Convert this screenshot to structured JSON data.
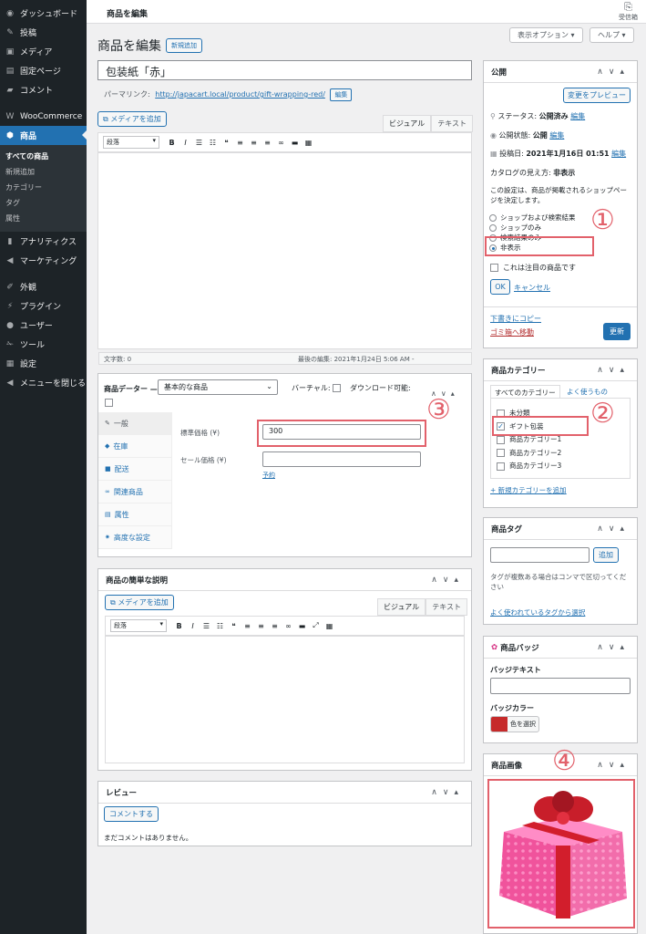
{
  "sidebar": {
    "items_top": [
      {
        "icon": "dashboard-icon",
        "glyph": "◉",
        "label": "ダッシュボード"
      },
      {
        "icon": "pin-icon",
        "glyph": "✎",
        "label": "投稿"
      },
      {
        "icon": "media-icon",
        "glyph": "▣",
        "label": "メディア"
      },
      {
        "icon": "page-icon",
        "glyph": "▤",
        "label": "固定ページ"
      },
      {
        "icon": "comment-icon",
        "glyph": "▰",
        "label": "コメント"
      }
    ],
    "woocommerce": {
      "icon": "woo-icon",
      "glyph": "W",
      "label": "WooCommerce"
    },
    "products": {
      "icon": "box-icon",
      "glyph": "⬢",
      "label": "商品"
    },
    "sub_items": [
      "すべての商品",
      "新規追加",
      "カテゴリー",
      "タグ",
      "属性"
    ],
    "items_mid": [
      {
        "icon": "chart-icon",
        "glyph": "▮",
        "label": "アナリティクス"
      },
      {
        "icon": "megaphone-icon",
        "glyph": "◀",
        "label": "マーケティング"
      }
    ],
    "items_bottom": [
      {
        "icon": "brush-icon",
        "glyph": "✐",
        "label": "外観"
      },
      {
        "icon": "plugin-icon",
        "glyph": "⚡",
        "label": "プラグイン"
      },
      {
        "icon": "user-icon",
        "glyph": "●",
        "label": "ユーザー"
      },
      {
        "icon": "wrench-icon",
        "glyph": "✁",
        "label": "ツール"
      },
      {
        "icon": "settings-icon",
        "glyph": "▦",
        "label": "設定"
      },
      {
        "icon": "collapse-icon",
        "glyph": "◀",
        "label": "メニューを閉じる"
      }
    ]
  },
  "topbar": {
    "title": "商品を編集",
    "inbox": "受信箱"
  },
  "screen": {
    "options": "表示オプション ▾",
    "help": "ヘルプ ▾"
  },
  "page": {
    "heading": "商品を編集",
    "add_new": "新規追加",
    "title_value": "包装紙「赤」"
  },
  "permalink": {
    "label": "パーマリンク:",
    "url": "http://japacart.local/product/gift-wrapping-red/",
    "edit": "編集"
  },
  "editor": {
    "add_media": "メディアを追加",
    "tab_visual": "ビジュアル",
    "tab_text": "テキスト",
    "format": "段落",
    "word_count": "文字数: 0",
    "last_edit": "最後の編集: 2021年1月24日 5:06 AM -"
  },
  "product_data": {
    "title": "商品データー —",
    "type": "基本的な商品",
    "virtual": "バーチャル:",
    "downloadable": "ダウンロード可能:",
    "tabs": [
      {
        "icon": "wrench-tab-icon",
        "glyph": "✎",
        "label": "一般"
      },
      {
        "icon": "inventory-icon",
        "glyph": "◆",
        "label": "在庫"
      },
      {
        "icon": "truck-icon",
        "glyph": "■",
        "label": "配送"
      },
      {
        "icon": "link-icon",
        "glyph": "∞",
        "label": "関連商品"
      },
      {
        "icon": "table-icon",
        "glyph": "▤",
        "label": "属性"
      },
      {
        "icon": "gear-icon",
        "glyph": "✷",
        "label": "高度な設定"
      }
    ],
    "regular_price_label": "標準価格 (¥)",
    "regular_price": "300",
    "sale_price_label": "セール価格 (¥)",
    "sale_price": "",
    "schedule": "予約"
  },
  "short_desc": {
    "title": "商品の簡単な説明",
    "add_media": "メディアを追加",
    "tab_visual": "ビジュアル",
    "tab_text": "テキスト",
    "format": "段落"
  },
  "reviews": {
    "title": "レビュー",
    "button": "コメントする",
    "empty": "まだコメントはありません。"
  },
  "publish": {
    "title": "公開",
    "preview": "変更をプレビュー",
    "status_label": "ステータス:",
    "status_value": "公開済み",
    "edit": "編集",
    "visibility_label": "公開状態:",
    "visibility_value": "公開",
    "date_label": "投稿日:",
    "date_value": "2021年1月16日 01:51",
    "catalog_label": "カタログの見え方:",
    "catalog_value": "非表示",
    "catalog_desc": "この設定は、商品が掲載されるショップページを決定します。",
    "options": [
      "ショップおよび検索結果",
      "ショップのみ",
      "検索結果のみ",
      "非表示"
    ],
    "selected_index": 3,
    "featured": "これは注目の商品です",
    "ok": "OK",
    "cancel": "キャンセル",
    "copy_draft": "下書きにコピー",
    "trash": "ゴミ箱へ移動",
    "update": "更新"
  },
  "categories": {
    "title": "商品カテゴリー",
    "tab_all": "すべてのカテゴリー",
    "tab_popular": "よく使うもの",
    "items": [
      {
        "label": "未分類",
        "checked": false
      },
      {
        "label": "ギフト包装",
        "checked": true
      },
      {
        "label": "商品カテゴリー1",
        "checked": false
      },
      {
        "label": "商品カテゴリー2",
        "checked": false
      },
      {
        "label": "商品カテゴリー3",
        "checked": false
      }
    ],
    "add_new": "+ 新規カテゴリーを追加"
  },
  "tags": {
    "title": "商品タグ",
    "add": "追加",
    "help": "タグが複数ある場合はコンマで区切ってください",
    "popular": "よく使われているタグから選択"
  },
  "badge": {
    "title": "商品バッジ",
    "text_label": "バッジテキスト",
    "color_label": "バッジカラー",
    "color_button": "色を選択",
    "color": "#c62a2a"
  },
  "product_image": {
    "title": "商品画像"
  },
  "annotations": [
    "①",
    "②",
    "③",
    "④"
  ],
  "colors": {
    "accent": "#2271b1",
    "annotation": "#e2616b",
    "sidebar": "#1d2327"
  }
}
